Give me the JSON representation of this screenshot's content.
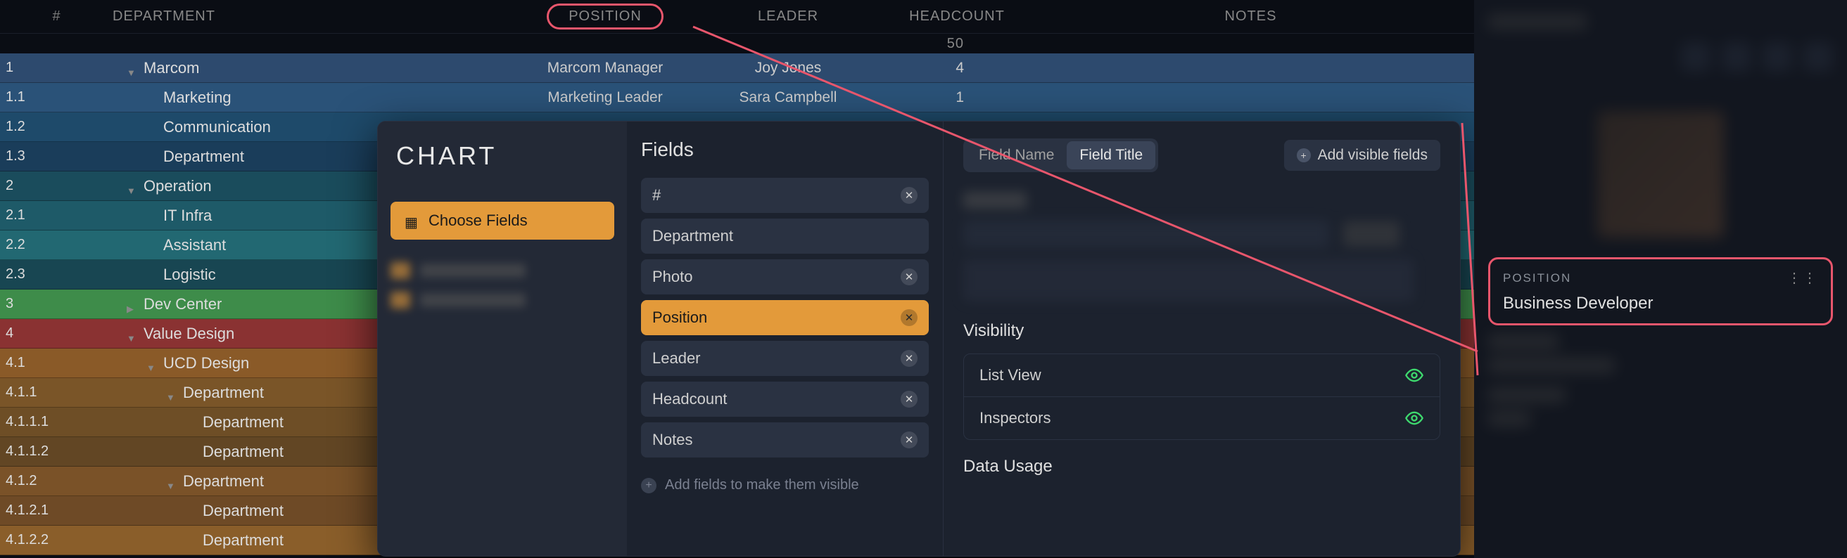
{
  "columns": {
    "num": "#",
    "dept": "DEPARTMENT",
    "pos": "POSITION",
    "leader": "LEADER",
    "head": "HEADCOUNT",
    "notes": "NOTES"
  },
  "summary_head": "50",
  "rows": [
    {
      "num": "1",
      "dept": "Marcom",
      "pos": "Marcom Manager",
      "leader": "Joy Jones",
      "head": "4",
      "cls": "c-blue1",
      "chev": "down",
      "indent": 0
    },
    {
      "num": "1.1",
      "dept": "Marketing",
      "pos": "Marketing Leader",
      "leader": "Sara Campbell",
      "head": "1",
      "cls": "c-blue2",
      "chev": "none",
      "indent": 1
    },
    {
      "num": "1.2",
      "dept": "Communication",
      "pos": "",
      "leader": "",
      "head": "",
      "cls": "c-blue3",
      "chev": "none",
      "indent": 1
    },
    {
      "num": "1.3",
      "dept": "Department",
      "pos": "",
      "leader": "",
      "head": "",
      "cls": "c-blue4",
      "chev": "none",
      "indent": 1
    },
    {
      "num": "2",
      "dept": "Operation",
      "pos": "",
      "leader": "",
      "head": "",
      "cls": "c-teal",
      "chev": "down",
      "indent": 0
    },
    {
      "num": "2.1",
      "dept": "IT Infra",
      "pos": "",
      "leader": "",
      "head": "",
      "cls": "c-teal2",
      "chev": "none",
      "indent": 1
    },
    {
      "num": "2.2",
      "dept": "Assistant",
      "pos": "",
      "leader": "",
      "head": "",
      "cls": "c-teal3",
      "chev": "none",
      "indent": 1
    },
    {
      "num": "2.3",
      "dept": "Logistic",
      "pos": "",
      "leader": "",
      "head": "",
      "cls": "c-teal4",
      "chev": "none",
      "indent": 1
    },
    {
      "num": "3",
      "dept": "Dev Center",
      "pos": "",
      "leader": "",
      "head": "",
      "cls": "c-green-bright",
      "chev": "right",
      "indent": 0
    },
    {
      "num": "4",
      "dept": "Value Design",
      "pos": "",
      "leader": "",
      "head": "",
      "cls": "c-red",
      "chev": "down",
      "indent": 0
    },
    {
      "num": "4.1",
      "dept": "UCD Design",
      "pos": "",
      "leader": "",
      "head": "",
      "cls": "c-orange1",
      "chev": "down",
      "indent": 1
    },
    {
      "num": "4.1.1",
      "dept": "Department",
      "pos": "",
      "leader": "",
      "head": "",
      "cls": "c-orange2",
      "chev": "down",
      "indent": 2
    },
    {
      "num": "4.1.1.1",
      "dept": "Department",
      "pos": "",
      "leader": "",
      "head": "",
      "cls": "c-orange3",
      "chev": "none",
      "indent": 3
    },
    {
      "num": "4.1.1.2",
      "dept": "Department",
      "pos": "",
      "leader": "",
      "head": "",
      "cls": "c-orange4",
      "chev": "none",
      "indent": 3
    },
    {
      "num": "4.1.2",
      "dept": "Department",
      "pos": "",
      "leader": "",
      "head": "",
      "cls": "c-orange5",
      "chev": "down",
      "indent": 2
    },
    {
      "num": "4.1.2.1",
      "dept": "Department",
      "pos": "",
      "leader": "",
      "head": "",
      "cls": "c-orange6",
      "chev": "none",
      "indent": 3
    },
    {
      "num": "4.1.2.2",
      "dept": "Department",
      "pos": "",
      "leader": "",
      "head": "",
      "cls": "c-orange7",
      "chev": "none",
      "indent": 3
    }
  ],
  "modal": {
    "chart_title": "CHART",
    "choose_fields": "Choose Fields",
    "fields_title": "Fields",
    "fields": [
      {
        "label": "#",
        "removable": true
      },
      {
        "label": "Department",
        "removable": false
      },
      {
        "label": "Photo",
        "removable": true
      },
      {
        "label": "Position",
        "removable": true,
        "selected": true
      },
      {
        "label": "Leader",
        "removable": true
      },
      {
        "label": "Headcount",
        "removable": true
      },
      {
        "label": "Notes",
        "removable": true
      }
    ],
    "add_hint": "Add fields to make them visible",
    "toggle": {
      "a": "Field Name",
      "b": "Field Title",
      "active": "b"
    },
    "add_visible": "Add visible fields",
    "visibility_title": "Visibility",
    "vis_rows": [
      "List View",
      "Inspectors"
    ],
    "data_usage": "Data Usage"
  },
  "sidebar": {
    "pos_label": "POSITION",
    "pos_value": "Business Developer"
  }
}
